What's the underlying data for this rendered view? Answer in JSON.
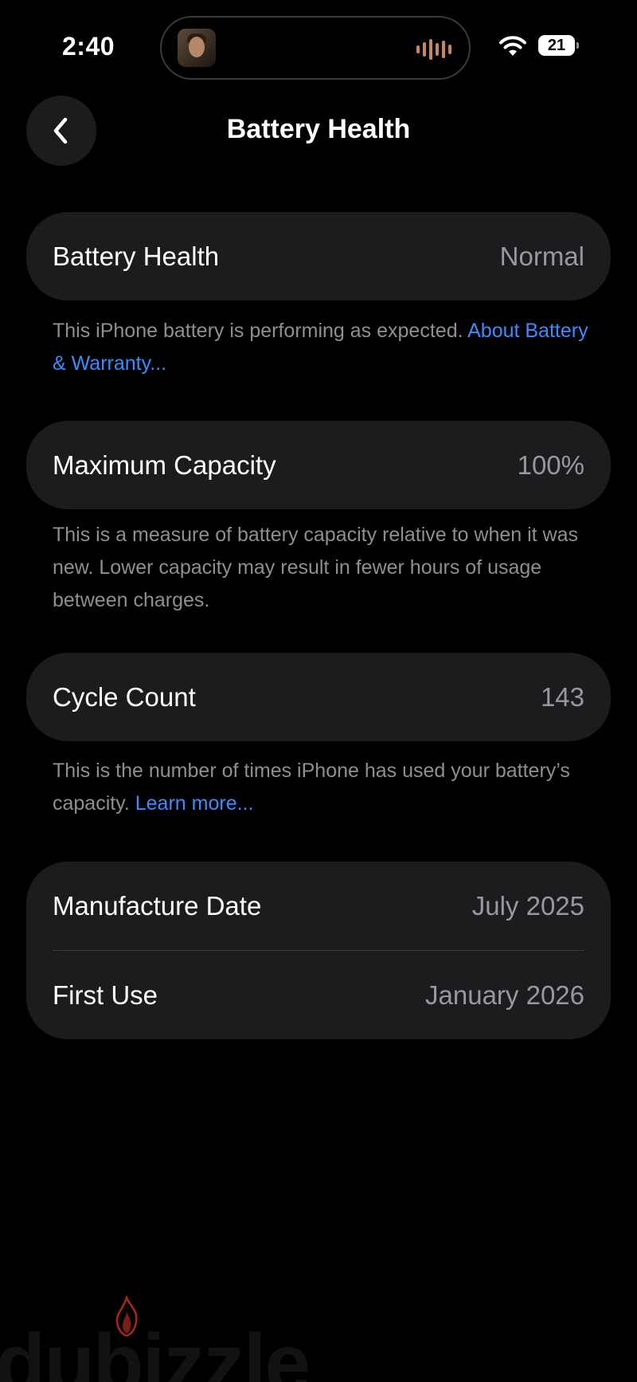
{
  "status_bar": {
    "time": "2:40",
    "battery_level": "21",
    "icons": [
      "now-playing-thumbnail",
      "waveform-icon",
      "wifi-icon",
      "battery-icon"
    ]
  },
  "nav": {
    "back_icon": "chevron-left-icon",
    "title": "Battery Health"
  },
  "sections": {
    "health": {
      "label": "Battery Health",
      "value": "Normal",
      "footnote_text": "This iPhone battery is performing as expected. ",
      "footnote_link": "About Battery & Warranty..."
    },
    "capacity": {
      "label": "Maximum Capacity",
      "value": "100%",
      "footnote_text": "This is a measure of battery capacity relative to when it was new. Lower capacity may result in fewer hours of usage between charges."
    },
    "cycles": {
      "label": "Cycle Count",
      "value": "143",
      "footnote_text": "This is the number of times iPhone has used your battery’s capacity. ",
      "footnote_link": "Learn more..."
    },
    "dates": {
      "manufacture_label": "Manufacture Date",
      "manufacture_value": "July 2025",
      "first_use_label": "First Use",
      "first_use_value": "January 2026"
    }
  },
  "watermark": {
    "text": "dubizzle"
  },
  "colors": {
    "background": "#000000",
    "card": "#1c1c1e",
    "secondary_text": "#98989d",
    "footnote_text": "#8e8e93",
    "link": "#3a8cff",
    "watermark_flame": "#e0362c"
  }
}
